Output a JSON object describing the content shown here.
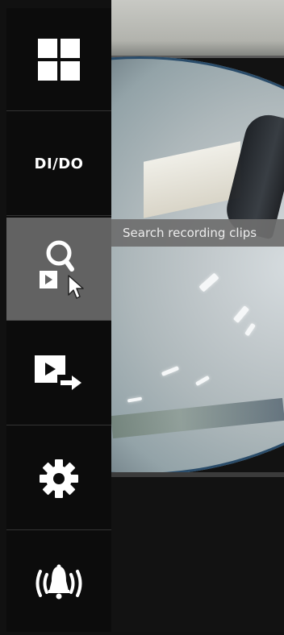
{
  "sidebar": {
    "items": [
      {
        "id": "layout",
        "icon": "grid-icon"
      },
      {
        "id": "dido",
        "label": "DI/DO"
      },
      {
        "id": "search",
        "icon": "search-clip-icon",
        "active": true
      },
      {
        "id": "export",
        "icon": "export-video-icon"
      },
      {
        "id": "settings",
        "icon": "gear-icon"
      },
      {
        "id": "alarm",
        "icon": "alarm-bell-icon"
      }
    ]
  },
  "tooltip": {
    "text": "Search recording clips"
  },
  "colors": {
    "sidebar_bg": "#0c0c0c",
    "active_bg": "#626262",
    "icon": "#ffffff"
  }
}
